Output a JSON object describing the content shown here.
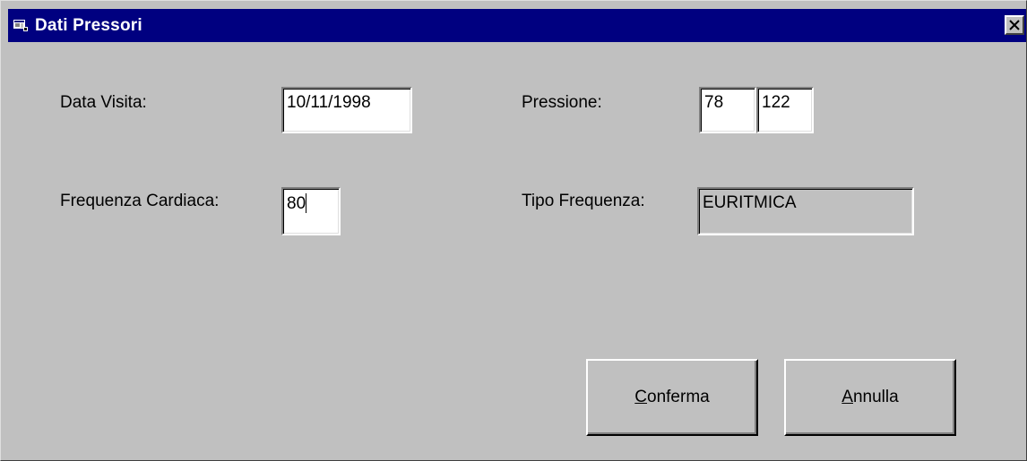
{
  "window": {
    "title": "Dati Pressori",
    "icon": "app-window-icon",
    "close_icon": "close-icon"
  },
  "form": {
    "data_visita": {
      "label": "Data Visita:",
      "value": "10/11/1998"
    },
    "pressione": {
      "label": "Pressione:",
      "value_min": "78",
      "value_max": "122"
    },
    "frequenza_cardiaca": {
      "label": "Frequenza Cardiaca:",
      "value": "80"
    },
    "tipo_frequenza": {
      "label": "Tipo Frequenza:",
      "value": "EURITMICA"
    }
  },
  "buttons": {
    "confirm": {
      "mnemonic": "C",
      "rest": "onferma"
    },
    "cancel": {
      "mnemonic": "A",
      "rest": "nnulla"
    }
  },
  "colors": {
    "titlebar": "#000080",
    "face": "#c0c0c0",
    "field": "#ffffff"
  }
}
